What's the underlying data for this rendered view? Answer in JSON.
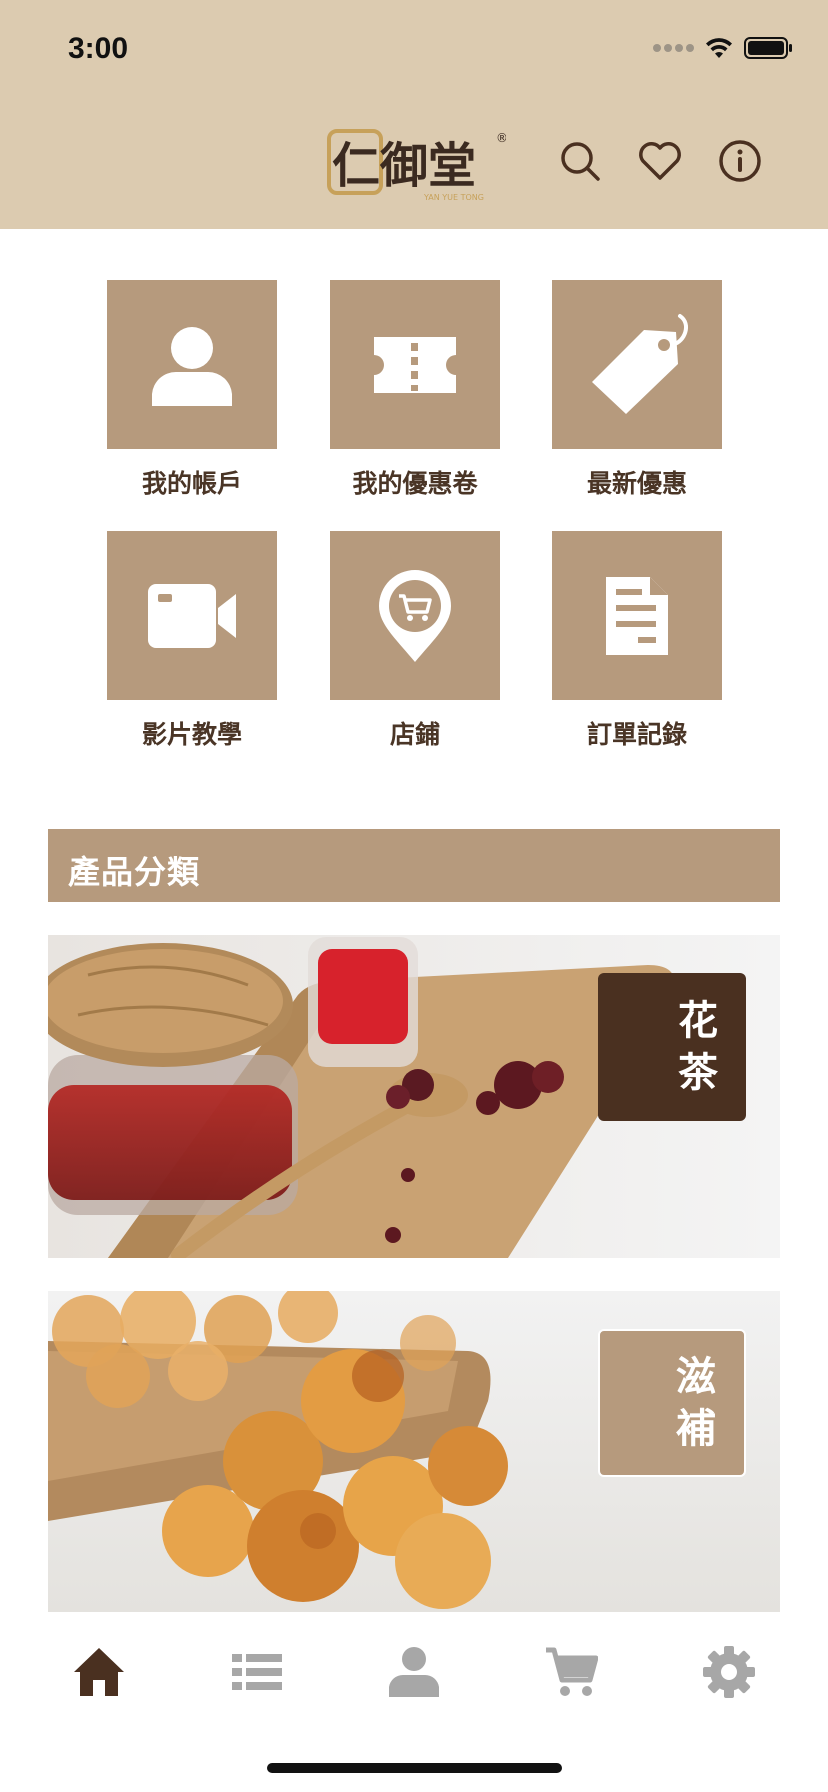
{
  "status_bar": {
    "time": "3:00"
  },
  "header": {
    "logo_text": "仁御堂",
    "logo_subtext": "YAN YUE TONG",
    "logo_mark": "®"
  },
  "menu": {
    "items": [
      {
        "label": "我的帳戶",
        "icon": "user-icon"
      },
      {
        "label": "我的優惠卷",
        "icon": "ticket-icon"
      },
      {
        "label": "最新優惠",
        "icon": "price-tag-icon"
      },
      {
        "label": "影片教學",
        "icon": "video-camera-icon"
      },
      {
        "label": "店鋪",
        "icon": "shop-location-icon"
      },
      {
        "label": "訂單記錄",
        "icon": "document-icon"
      }
    ]
  },
  "categories": {
    "title": "產品分類",
    "items": [
      {
        "line1": "花",
        "line2": "茶",
        "tag_color": "#4a3020"
      },
      {
        "line1": "滋",
        "line2": "補",
        "tag_color": "#b69a7d"
      }
    ]
  },
  "tabbar": {
    "items": [
      {
        "icon": "home-icon",
        "active": true
      },
      {
        "icon": "list-icon",
        "active": false
      },
      {
        "icon": "person-icon",
        "active": false
      },
      {
        "icon": "cart-icon",
        "active": false
      },
      {
        "icon": "gear-icon",
        "active": false
      }
    ]
  },
  "colors": {
    "header_bg": "#dccbb0",
    "accent": "#b69a7d",
    "dark_brown": "#4a3020",
    "tab_inactive": "#a7a7a7"
  }
}
